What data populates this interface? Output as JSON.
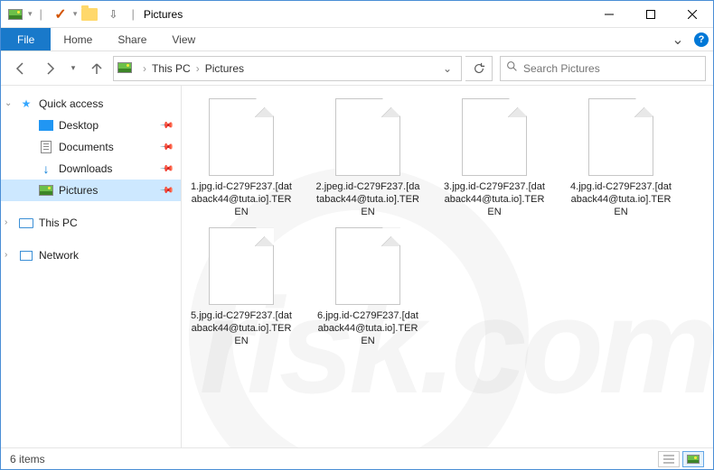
{
  "title": "Pictures",
  "ribbon": {
    "file": "File",
    "tabs": [
      "Home",
      "Share",
      "View"
    ]
  },
  "breadcrumb": [
    "This PC",
    "Pictures"
  ],
  "search": {
    "placeholder": "Search Pictures"
  },
  "sidebar": {
    "quick": {
      "label": "Quick access",
      "items": [
        {
          "label": "Desktop",
          "icon": "desktop",
          "pinned": true
        },
        {
          "label": "Documents",
          "icon": "documents",
          "pinned": true
        },
        {
          "label": "Downloads",
          "icon": "downloads",
          "pinned": true
        },
        {
          "label": "Pictures",
          "icon": "pictures",
          "pinned": true,
          "selected": true
        }
      ]
    },
    "thispc": {
      "label": "This PC"
    },
    "network": {
      "label": "Network"
    }
  },
  "files": [
    "1.jpg.id-C279F237.[databack44@tuta.io].TEREN",
    "2.jpeg.id-C279F237.[databack44@tuta.io].TEREN",
    "3.jpg.id-C279F237.[databack44@tuta.io].TEREN",
    "4.jpg.id-C279F237.[databack44@tuta.io].TEREN",
    "5.jpg.id-C279F237.[databack44@tuta.io].TEREN",
    "6.jpg.id-C279F237.[databack44@tuta.io].TEREN"
  ],
  "status": {
    "count": "6 items"
  },
  "watermark": "risk.com"
}
